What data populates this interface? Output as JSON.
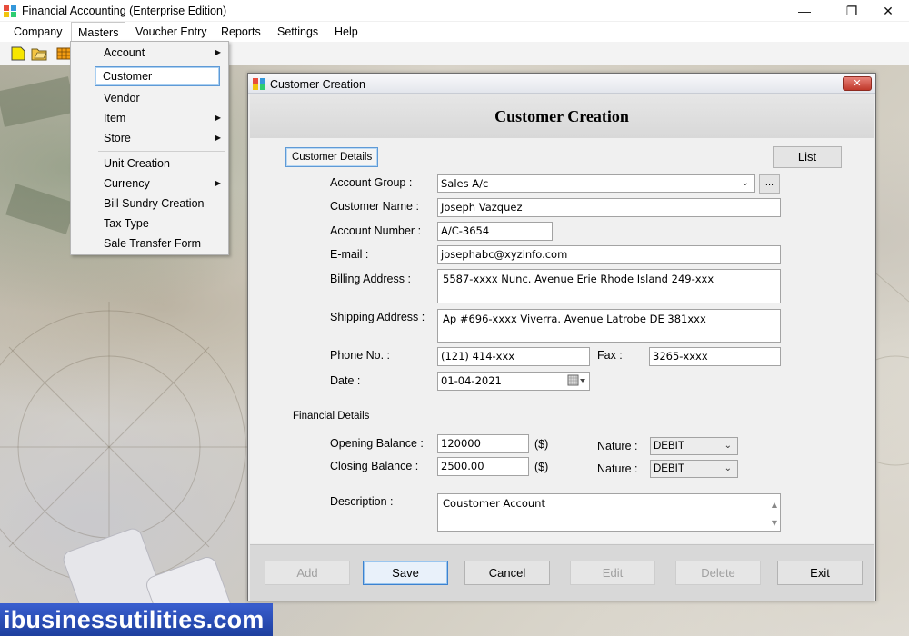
{
  "window": {
    "title": "Financial Accounting (Enterprise Edition)",
    "minimize_glyph": "—",
    "restore_glyph": "❐",
    "close_glyph": "✕"
  },
  "menubar": {
    "items": [
      {
        "label": "Company"
      },
      {
        "label": "Masters"
      },
      {
        "label": "Voucher Entry"
      },
      {
        "label": "Reports"
      },
      {
        "label": "Settings"
      },
      {
        "label": "Help"
      }
    ],
    "active": "Masters"
  },
  "masters_menu": {
    "items": [
      {
        "label": "Account",
        "submenu": true
      },
      {
        "label": "Customer",
        "highlighted": true
      },
      {
        "label": "Vendor"
      },
      {
        "label": "Item",
        "submenu": true
      },
      {
        "label": "Store",
        "submenu": true
      },
      {
        "label": "Unit Creation"
      },
      {
        "label": "Currency",
        "submenu": true
      },
      {
        "label": "Bill Sundry Creation"
      },
      {
        "label": "Tax Type"
      },
      {
        "label": "Sale Transfer Form"
      }
    ],
    "arrow_glyph": "▶"
  },
  "dialog": {
    "title": "Customer Creation",
    "close_glyph": "✕",
    "heading": "Customer Creation",
    "customer_details_tab": "Customer Details",
    "list_button": "List",
    "fields": {
      "account_group": {
        "label": "Account Group :",
        "value": "Sales A/c",
        "browse": "..."
      },
      "customer_name": {
        "label": "Customer Name :",
        "value": "Joseph Vazquez"
      },
      "account_number": {
        "label": "Account Number :",
        "value": "A/C-3654"
      },
      "email": {
        "label": "E-mail :",
        "value": "josephabc@xyzinfo.com"
      },
      "billing_address": {
        "label": "Billing Address :",
        "value": "5587-xxxx Nunc. Avenue Erie Rhode Island 249-xxx"
      },
      "shipping_address": {
        "label": "Shipping Address :",
        "value": "Ap #696-xxxx Viverra. Avenue Latrobe DE 381xxx"
      },
      "phone": {
        "label": "Phone No. :",
        "value": "(121) 414-xxx"
      },
      "fax": {
        "label": "Fax :",
        "value": "3265-xxxx"
      },
      "date": {
        "label": "Date :",
        "value": "01-04-2021"
      }
    },
    "financial_details_tab": "Financial Details",
    "financial": {
      "opening_balance": {
        "label": "Opening Balance :",
        "value": "120000",
        "currency": "($)"
      },
      "closing_balance": {
        "label": "Closing Balance :",
        "value": "2500.00",
        "currency": "($)"
      },
      "nature_opening": {
        "label": "Nature :",
        "value": "DEBIT"
      },
      "nature_closing": {
        "label": "Nature :",
        "value": "DEBIT"
      },
      "description": {
        "label": "Description :",
        "value": "Coustomer Account"
      }
    },
    "buttons": {
      "add": {
        "label": "Add",
        "enabled": false
      },
      "save": {
        "label": "Save",
        "enabled": true,
        "focused": true
      },
      "cancel": {
        "label": "Cancel",
        "enabled": true
      },
      "edit": {
        "label": "Edit",
        "enabled": false
      },
      "delete": {
        "label": "Delete",
        "enabled": false
      },
      "exit": {
        "label": "Exit",
        "enabled": true
      }
    }
  },
  "branding": {
    "text": "ibusinessutilities.com"
  },
  "colors": {
    "brand_blue": "#2b4fbf",
    "focus_blue": "#5f9ad6",
    "close_red": "#c0392b"
  },
  "icons": [
    "app-logo-icon",
    "new-file-icon",
    "open-folder-icon",
    "calendar-icon",
    "chevron-down-icon",
    "submenu-arrow-icon",
    "close-icon"
  ]
}
